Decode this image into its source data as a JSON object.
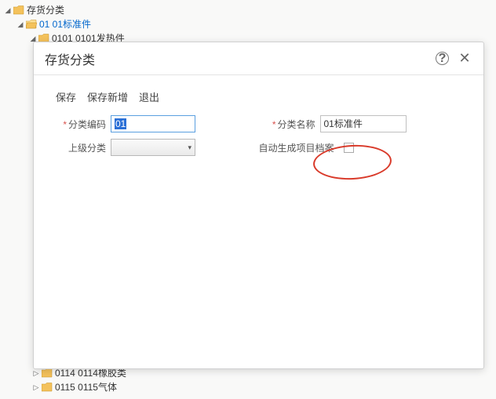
{
  "tree": {
    "root": "存货分类",
    "item_01": "01 01标准件",
    "item_0101": "0101 0101发热件",
    "item_0114": "0114 0114橡胶类",
    "item_0115": "0115 0115气体"
  },
  "dialog": {
    "title": "存货分类",
    "toolbar": {
      "save": "保存",
      "save_new": "保存新增",
      "exit": "退出"
    },
    "form": {
      "code_label": "分类编码",
      "code_value": "01",
      "name_label": "分类名称",
      "name_value": "01标准件",
      "parent_label": "上级分类",
      "parent_value": "",
      "autogen_label": "自动生成项目档案"
    }
  }
}
